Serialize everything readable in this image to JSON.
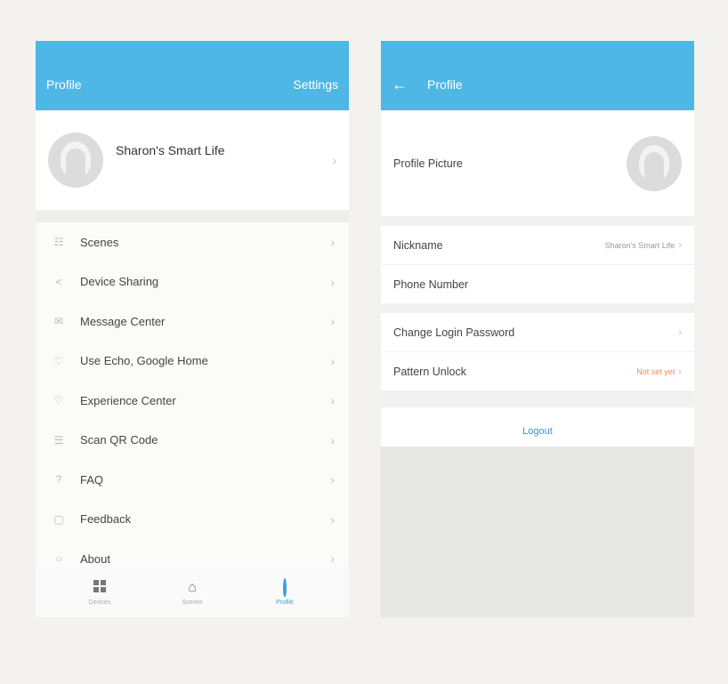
{
  "left": {
    "status": {
      "carrier": "",
      "time": "",
      "battery": ""
    },
    "header": {
      "title": "Profile",
      "action": "Settings"
    },
    "profile": {
      "name": "Sharon's Smart Life"
    },
    "menu": [
      {
        "label": "Scenes",
        "icon": "scenes-icon"
      },
      {
        "label": "Device Sharing",
        "icon": "share-icon"
      },
      {
        "label": "Message Center",
        "icon": "message-icon"
      },
      {
        "label": "Use Echo, Google Home",
        "icon": "echo-icon"
      },
      {
        "label": "Experience Center",
        "icon": "experience-icon"
      },
      {
        "label": "Scan QR Code",
        "icon": "scan-icon"
      },
      {
        "label": "FAQ",
        "icon": "faq-icon"
      },
      {
        "label": "Feedback",
        "icon": "feedback-icon"
      },
      {
        "label": "About",
        "icon": "about-icon"
      }
    ],
    "tabs": [
      {
        "label": "Devices",
        "icon": "devices-icon"
      },
      {
        "label": "Scenes",
        "icon": "home-icon"
      },
      {
        "label": "Profile",
        "icon": "profile-icon"
      }
    ]
  },
  "right": {
    "header": {
      "title": "Profile"
    },
    "rows": {
      "profile_picture": "Profile Picture",
      "nickname": "Nickname",
      "nickname_value": "Sharon's Smart Life",
      "phone": "Phone Number",
      "change_password": "Change Login Password",
      "pattern_unlock": "Pattern Unlock",
      "pattern_value": "Not set yet"
    },
    "logout": "Logout"
  },
  "colors": {
    "accent": "#4eb7e6",
    "tab_active": "#3aa3d8",
    "warning": "#ef8b5a",
    "link": "#3e92c8"
  }
}
